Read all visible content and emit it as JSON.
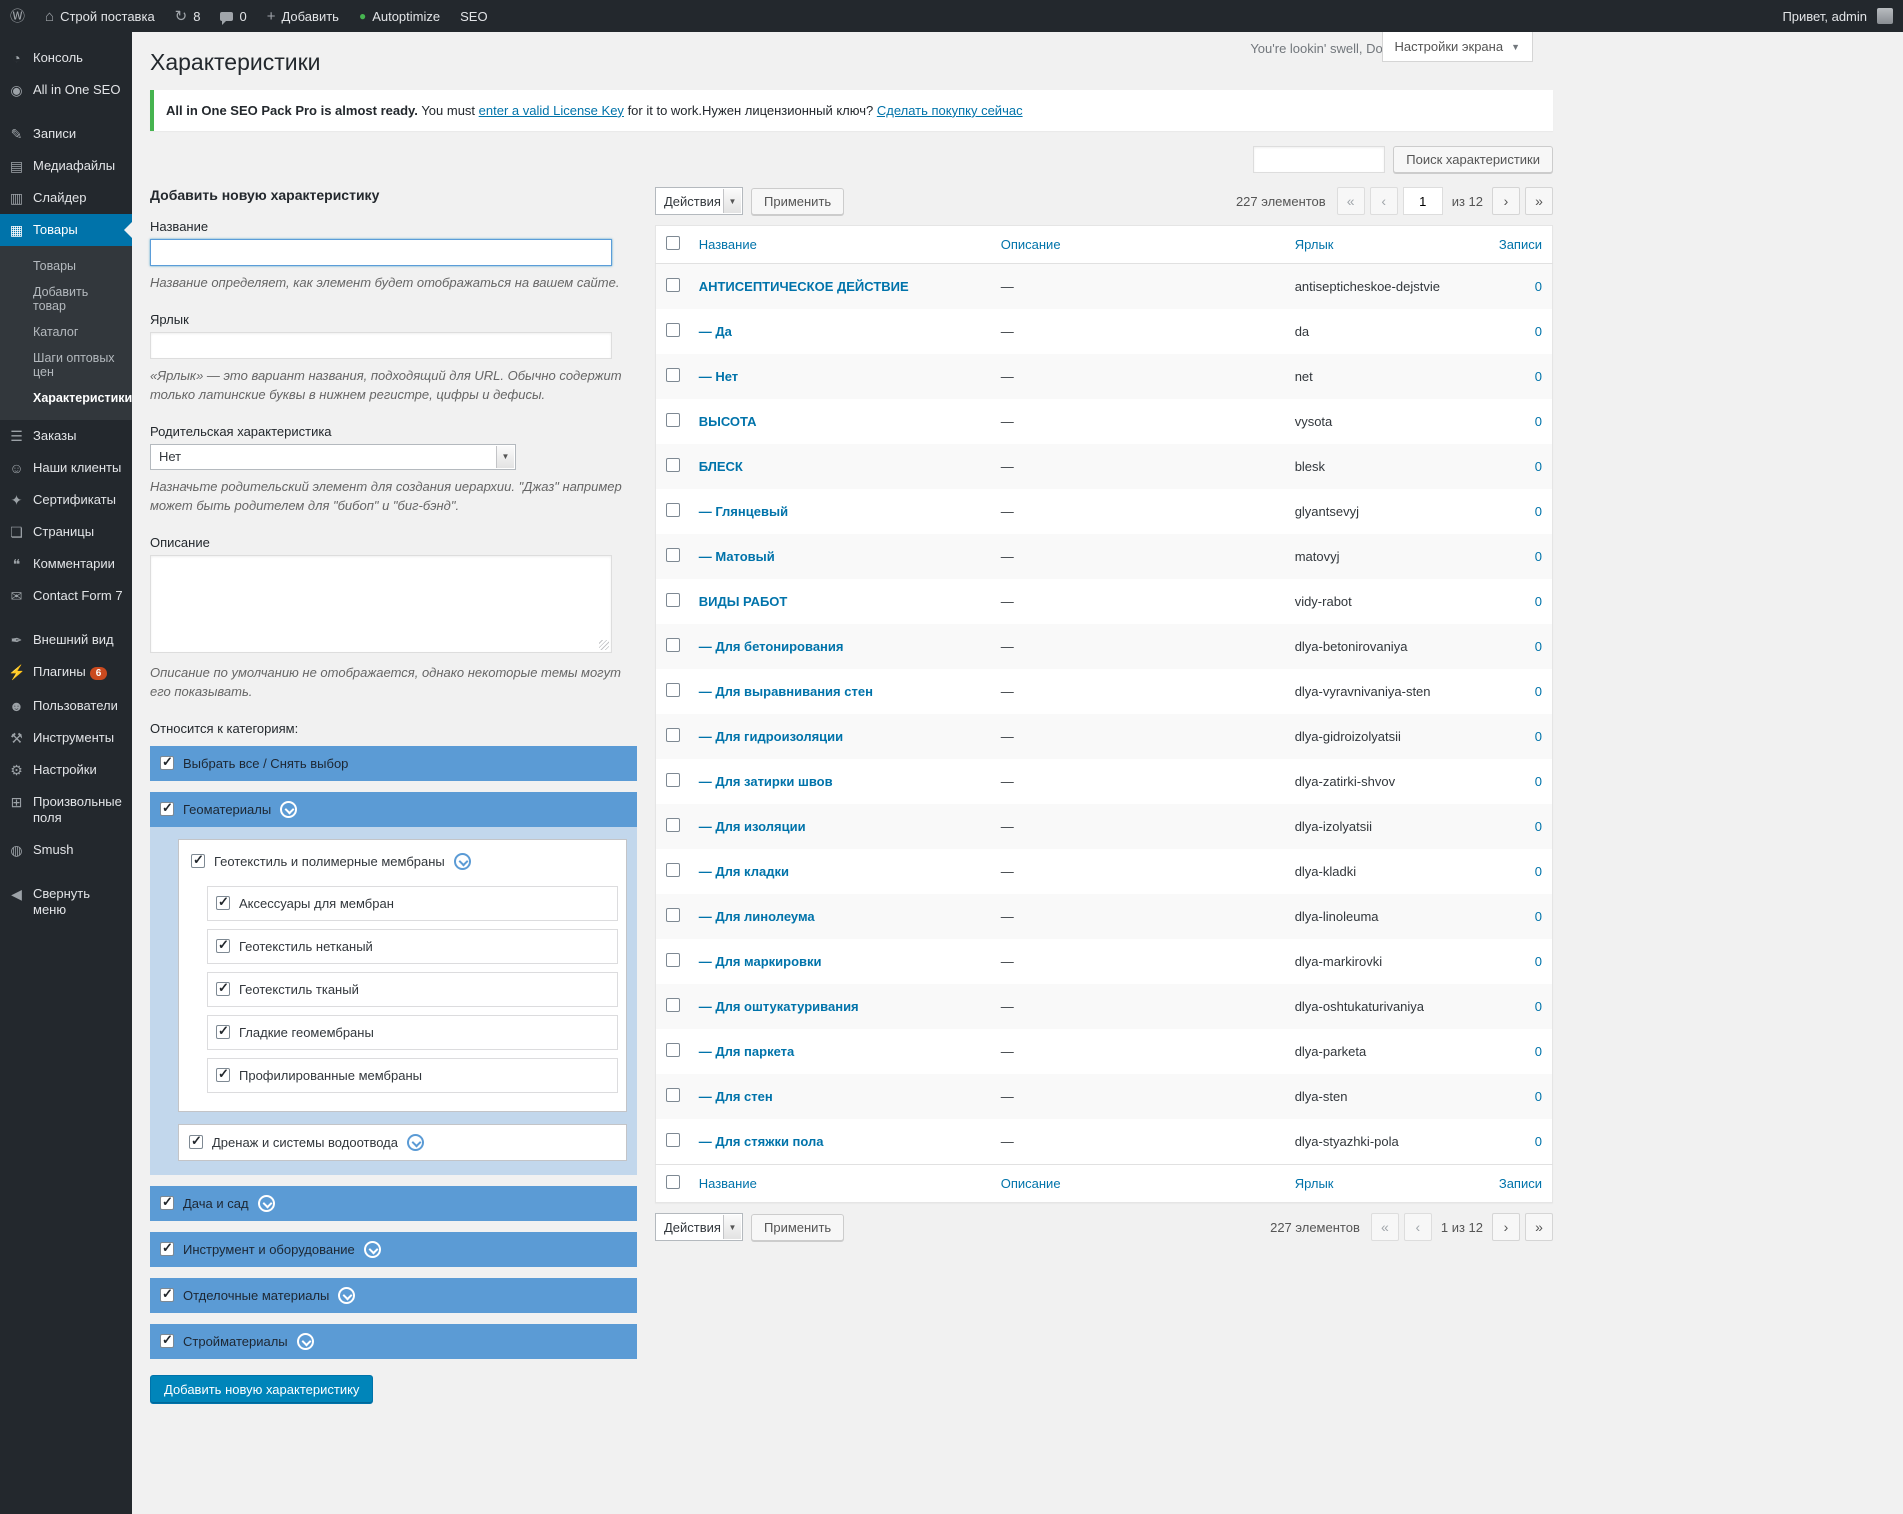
{
  "admin_bar": {
    "site_name": "Строй поставка",
    "updates_count": "8",
    "comments_count": "0",
    "add_new": "Добавить",
    "autoptimize": "Autoptimize",
    "seo": "SEO",
    "greeting": "Привет, admin"
  },
  "icons": {
    "wp_logo": "Ⓦ",
    "home": "⌂",
    "updates": "↻",
    "plus": "+",
    "autoptimize_dot": "●",
    "dashboard": "◔",
    "aioseo": "◉",
    "posts": "✎",
    "media": "▤",
    "slider": "▥",
    "products": "▦",
    "orders": "☰",
    "clients": "☺",
    "certificates": "✦",
    "pages": "❏",
    "comments": "❝",
    "contact_form": "✉",
    "appearance": "✒",
    "plugins": "⚡",
    "users": "☻",
    "tools": "⚒",
    "settings": "⚙",
    "custom_fields": "⊞",
    "smush": "◍",
    "collapse": "◀",
    "chevron_down": "▼"
  },
  "sidebar": {
    "dashboard": "Консоль",
    "aioseo": "All in One SEO",
    "posts": "Записи",
    "media": "Медиафайлы",
    "slider": "Слайдер",
    "products": "Товары",
    "products_submenu": {
      "products": "Товары",
      "add_product": "Добавить товар",
      "catalog": "Каталог",
      "wholesale_steps": "Шаги оптовых цен",
      "attributes": "Характеристики"
    },
    "orders": "Заказы",
    "clients": "Наши клиенты",
    "certificates": "Сертификаты",
    "pages": "Страницы",
    "comments": "Комментарии",
    "contact_form": "Contact Form 7",
    "appearance": "Внешний вид",
    "plugins": "Плагины",
    "plugins_badge": "6",
    "users": "Пользователи",
    "tools": "Инструменты",
    "settings": "Настройки",
    "custom_fields": "Произвольные поля",
    "smush": "Smush",
    "collapse": "Свернуть меню"
  },
  "header": {
    "title": "Характеристики",
    "dolly": "You're lookin' swell, Dolly",
    "screen_options": "Настройки экрана"
  },
  "notice": {
    "bold": "All in One SEO Pack Pro is almost ready.",
    "pre_link": "You must",
    "link": "enter a valid License Key",
    "post_link": "for it to work.",
    "question": "Нужен лицензионный ключ?",
    "buy_link": "Сделать покупку сейчас"
  },
  "search": {
    "button": "Поиск характеристики"
  },
  "form": {
    "heading": "Добавить новую характеристику",
    "name_label": "Название",
    "name_help": "Название определяет, как элемент будет отображаться на вашем сайте.",
    "slug_label": "Ярлык",
    "slug_help": "«Ярлык» — это вариант названия, подходящий для URL. Обычно содержит только латинские буквы в нижнем регистре, цифры и дефисы.",
    "parent_label": "Родительская характеристика",
    "parent_value": "Нет",
    "parent_help": "Назначьте родительский элемент для создания иерархии. \"Джаз\" например может быть родителем для \"бибоп\" и \"биг-бэнд\".",
    "description_label": "Описание",
    "description_help": "Описание по умолчанию не отображается, однако некоторые темы могут его показывать.",
    "submit": "Добавить новую характеристику"
  },
  "categories": {
    "heading": "Относится к категориям:",
    "select_all": "Выбрать все / Снять выбор",
    "geomaterials": "Геоматериалы",
    "membranes_group": "Геотекстиль и полимерные мембраны",
    "membranes_items": [
      "Аксессуары для мембран",
      "Геотекстиль нетканый",
      "Геотекстиль тканый",
      "Гладкие геомембраны",
      "Профилированные мембраны"
    ],
    "drainage_group": "Дренаж и системы водоотвода",
    "other_categories": [
      "Дача и сад",
      "Инструмент и оборудование",
      "Отделочные материалы",
      "Стройматериалы"
    ]
  },
  "table": {
    "bulk_actions": "Действия",
    "apply": "Применить",
    "items_total": "227 элементов",
    "current_page": "1",
    "of_pages": "из 12",
    "bottom_page_info": "1 из 12",
    "headers": {
      "name": "Название",
      "description": "Описание",
      "slug": "Ярлык",
      "count": "Записи"
    },
    "rows": [
      {
        "name": "АНТИСЕПТИЧЕСКОЕ ДЕЙСТВИЕ",
        "description": "—",
        "slug": "antisepticheskoe-dejstvie",
        "count": "0"
      },
      {
        "name": "— Да",
        "description": "—",
        "slug": "da",
        "count": "0"
      },
      {
        "name": "— Нет",
        "description": "—",
        "slug": "net",
        "count": "0"
      },
      {
        "name": "ВЫСОТА",
        "description": "—",
        "slug": "vysota",
        "count": "0"
      },
      {
        "name": "БЛЕСК",
        "description": "—",
        "slug": "blesk",
        "count": "0"
      },
      {
        "name": "— Глянцевый",
        "description": "—",
        "slug": "glyantsevyj",
        "count": "0"
      },
      {
        "name": "— Матовый",
        "description": "—",
        "slug": "matovyj",
        "count": "0"
      },
      {
        "name": "ВИДЫ РАБОТ",
        "description": "—",
        "slug": "vidy-rabot",
        "count": "0"
      },
      {
        "name": "— Для бетонирования",
        "description": "—",
        "slug": "dlya-betonirovaniya",
        "count": "0"
      },
      {
        "name": "— Для выравнивания стен",
        "description": "—",
        "slug": "dlya-vyravnivaniya-sten",
        "count": "0"
      },
      {
        "name": "— Для гидроизоляции",
        "description": "—",
        "slug": "dlya-gidroizolyatsii",
        "count": "0"
      },
      {
        "name": "— Для затирки швов",
        "description": "—",
        "slug": "dlya-zatirki-shvov",
        "count": "0"
      },
      {
        "name": "— Для изоляции",
        "description": "—",
        "slug": "dlya-izolyatsii",
        "count": "0"
      },
      {
        "name": "— Для кладки",
        "description": "—",
        "slug": "dlya-kladki",
        "count": "0"
      },
      {
        "name": "— Для линолеума",
        "description": "—",
        "slug": "dlya-linoleuma",
        "count": "0"
      },
      {
        "name": "— Для маркировки",
        "description": "—",
        "slug": "dlya-markirovki",
        "count": "0"
      },
      {
        "name": "— Для оштукатуривания",
        "description": "—",
        "slug": "dlya-oshtukaturivaniya",
        "count": "0"
      },
      {
        "name": "— Для паркета",
        "description": "—",
        "slug": "dlya-parketa",
        "count": "0"
      },
      {
        "name": "— Для стен",
        "description": "—",
        "slug": "dlya-sten",
        "count": "0"
      },
      {
        "name": "— Для стяжки пола",
        "description": "—",
        "slug": "dlya-styazhki-pola",
        "count": "0"
      }
    ]
  },
  "pagination": {
    "first": "«",
    "prev": "‹",
    "next": "›",
    "last": "»"
  },
  "colors": {
    "accent_blue": "#0073aa",
    "menu_dark": "#23282d",
    "notice_green": "#46b450",
    "category_bar_blue": "#5b9bd5",
    "primary_button": "#0085ba"
  }
}
